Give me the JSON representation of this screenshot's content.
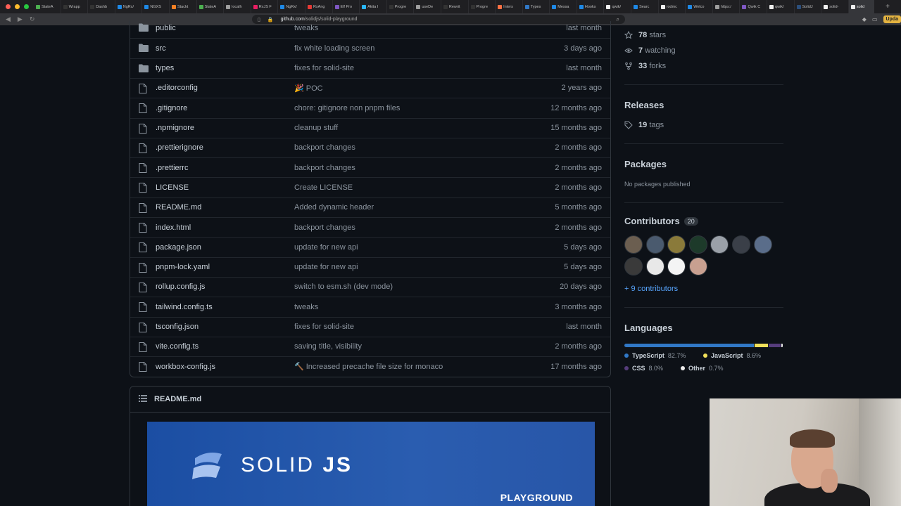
{
  "browser": {
    "tabs": [
      {
        "label": "StateA",
        "color": "#4caf50"
      },
      {
        "label": "Wrapp",
        "color": "#333333"
      },
      {
        "label": "Dashb",
        "color": "#333333"
      },
      {
        "label": "NgRx/",
        "color": "#1e88e5"
      },
      {
        "label": "NGXS",
        "color": "#1e88e5"
      },
      {
        "label": "Stackt",
        "color": "#f48024"
      },
      {
        "label": "StateA",
        "color": "#4caf50"
      },
      {
        "label": "localh",
        "color": "#9e9e9e"
      },
      {
        "label": "RxJS F",
        "color": "#e91e63"
      },
      {
        "label": "NgRx/",
        "color": "#1e88e5"
      },
      {
        "label": "RxAng",
        "color": "#e53935"
      },
      {
        "label": "Elf Pro",
        "color": "#7e57c2"
      },
      {
        "label": "Akita I",
        "color": "#29b6f6"
      },
      {
        "label": "Progre",
        "color": "#333333"
      },
      {
        "label": "useDe",
        "color": "#9e9e9e"
      },
      {
        "label": "Rewrit",
        "color": "#333333"
      },
      {
        "label": "Progre",
        "color": "#333333"
      },
      {
        "label": "Inters",
        "color": "#ff7043"
      },
      {
        "label": "Types",
        "color": "#3178c6"
      },
      {
        "label": "Messa",
        "color": "#1e88e5"
      },
      {
        "label": "Hooks",
        "color": "#1e88e5"
      },
      {
        "label": "qwik/",
        "color": "#eeeeee"
      },
      {
        "label": "Searc",
        "color": "#1e88e5"
      },
      {
        "label": "rodmc",
        "color": "#eeeeee"
      },
      {
        "label": "Welco",
        "color": "#1e88e5"
      },
      {
        "label": "https:/",
        "color": "#9e9e9e"
      },
      {
        "label": "Qwik C",
        "color": "#7e57c2"
      },
      {
        "label": "qwik/",
        "color": "#eeeeee"
      },
      {
        "label": "SolidJ",
        "color": "#2c4f7c"
      },
      {
        "label": "solid-",
        "color": "#eeeeee"
      },
      {
        "label": "solid",
        "color": "#eeeeee"
      }
    ],
    "url_domain": "github.com",
    "url_path": "/solidjs/solid-playground",
    "update_label": "Upda"
  },
  "files": [
    {
      "name": "public",
      "type": "dir",
      "message": "tweaks",
      "date": "last month"
    },
    {
      "name": "src",
      "type": "dir",
      "message": "fix white loading screen",
      "date": "3 days ago"
    },
    {
      "name": "types",
      "type": "dir",
      "message": "fixes for solid-site",
      "date": "last month"
    },
    {
      "name": ".editorconfig",
      "type": "file",
      "message": "🎉 POC",
      "date": "2 years ago"
    },
    {
      "name": ".gitignore",
      "type": "file",
      "message": "chore: gitignore non pnpm files",
      "date": "12 months ago"
    },
    {
      "name": ".npmignore",
      "type": "file",
      "message": "cleanup stuff",
      "date": "15 months ago"
    },
    {
      "name": ".prettierignore",
      "type": "file",
      "message": "backport changes",
      "date": "2 months ago"
    },
    {
      "name": ".prettierrc",
      "type": "file",
      "message": "backport changes",
      "date": "2 months ago"
    },
    {
      "name": "LICENSE",
      "type": "file",
      "message": "Create LICENSE",
      "date": "2 months ago"
    },
    {
      "name": "README.md",
      "type": "file",
      "message": "Added dynamic header",
      "date": "5 months ago"
    },
    {
      "name": "index.html",
      "type": "file",
      "message": "backport changes",
      "date": "2 months ago"
    },
    {
      "name": "package.json",
      "type": "file",
      "message": "update for new api",
      "date": "5 days ago"
    },
    {
      "name": "pnpm-lock.yaml",
      "type": "file",
      "message": "update for new api",
      "date": "5 days ago"
    },
    {
      "name": "rollup.config.js",
      "type": "file",
      "message": "switch to esm.sh (dev mode)",
      "date": "20 days ago"
    },
    {
      "name": "tailwind.config.ts",
      "type": "file",
      "message": "tweaks",
      "date": "3 months ago"
    },
    {
      "name": "tsconfig.json",
      "type": "file",
      "message": "fixes for solid-site",
      "date": "last month"
    },
    {
      "name": "vite.config.ts",
      "type": "file",
      "message": "saving title, visibility",
      "date": "2 months ago"
    },
    {
      "name": "workbox-config.js",
      "type": "file",
      "message": "🔨 Increased precache file size for monaco",
      "date": "17 months ago"
    }
  ],
  "readme": {
    "title": "README.md",
    "logo_light": "SOLID",
    "logo_bold": "JS",
    "subtitle": "PLAYGROUND"
  },
  "sidebar": {
    "stats": [
      {
        "icon": "star-icon",
        "count": "78",
        "label": "stars"
      },
      {
        "icon": "eye-icon",
        "count": "7",
        "label": "watching"
      },
      {
        "icon": "fork-icon",
        "count": "33",
        "label": "forks"
      }
    ],
    "releases": {
      "title": "Releases",
      "tags_count": "19",
      "tags_label": "tags"
    },
    "packages": {
      "title": "Packages",
      "empty": "No packages published"
    },
    "contributors": {
      "title": "Contributors",
      "count": "20",
      "more": "+ 9 contributors",
      "avatar_colors": [
        "#6b5e50",
        "#4a5a6e",
        "#8a7a3a",
        "#1d3a2a",
        "#9aa0a8",
        "#3a3f48",
        "#5a6d8a",
        "#3a3a3a",
        "#e8e8e8",
        "#f4f4f4",
        "#c8a090"
      ]
    },
    "languages": {
      "title": "Languages",
      "items": [
        {
          "name": "TypeScript",
          "percent": "82.7%",
          "share": 82.7,
          "color": "#3178c6"
        },
        {
          "name": "JavaScript",
          "percent": "8.6%",
          "share": 8.6,
          "color": "#f1e05a"
        },
        {
          "name": "CSS",
          "percent": "8.0%",
          "share": 8.0,
          "color": "#563d7c"
        },
        {
          "name": "Other",
          "percent": "0.7%",
          "share": 0.7,
          "color": "#ededed"
        }
      ]
    }
  }
}
